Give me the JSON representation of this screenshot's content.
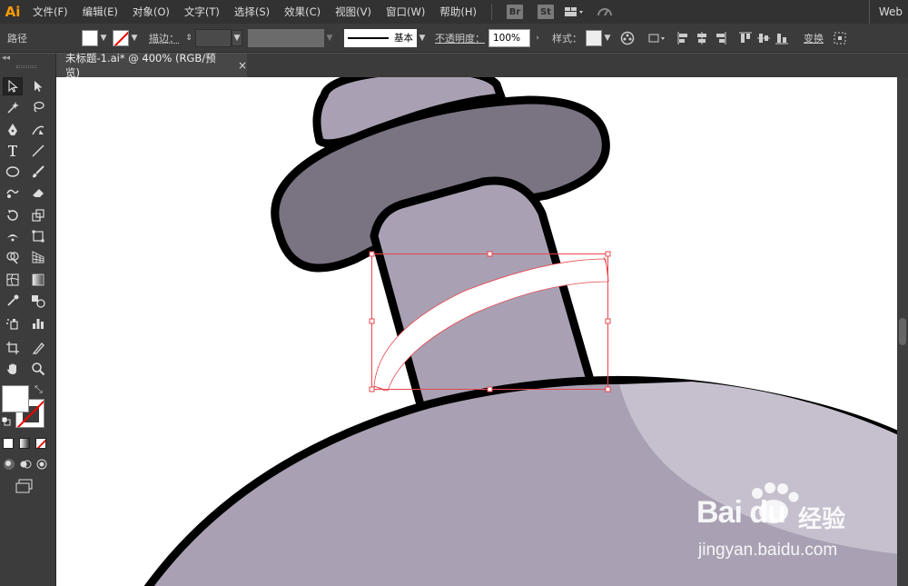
{
  "app": {
    "logo": "Ai",
    "workspace": "Web"
  },
  "menu": [
    "文件(F)",
    "编辑(E)",
    "对象(O)",
    "文字(T)",
    "选择(S)",
    "效果(C)",
    "视图(V)",
    "窗口(W)",
    "帮助(H)"
  ],
  "app_badges": {
    "bridge": "Br",
    "stock": "St"
  },
  "control": {
    "selection_type": "路径",
    "stroke_label": "描边：",
    "stroke_profile": "基本",
    "opacity_label": "不透明度：",
    "opacity_value": "100%",
    "style_label": "样式：",
    "transform_label": "变换"
  },
  "document_tab": {
    "title": "未标题-1.ai* @ 400% (RGB/预览)",
    "close": "×"
  },
  "watermark": {
    "brand": "Bai du",
    "jingyan": "经验",
    "url": "jingyan.baidu.com"
  },
  "colors": {
    "accent_selection": "#e8454c",
    "shape_fill": "#a9a1b3",
    "shape_dark": "#7a7381",
    "outline": "#000000"
  },
  "tools": [
    "selection-tool",
    "direct-selection-tool",
    "magic-wand-tool",
    "lasso-tool",
    "pen-tool",
    "curvature-tool",
    "type-tool",
    "line-tool",
    "ellipse-tool",
    "paintbrush-tool",
    "shaper-tool",
    "eraser-tool",
    "rotate-tool",
    "scale-tool",
    "width-tool",
    "free-transform-tool",
    "shape-builder-tool",
    "perspective-grid-tool",
    "mesh-tool",
    "gradient-tool",
    "eyedropper-tool",
    "blend-tool",
    "symbol-sprayer-tool",
    "column-graph-tool",
    "artboard-tool",
    "slice-tool",
    "hand-tool",
    "zoom-tool"
  ]
}
